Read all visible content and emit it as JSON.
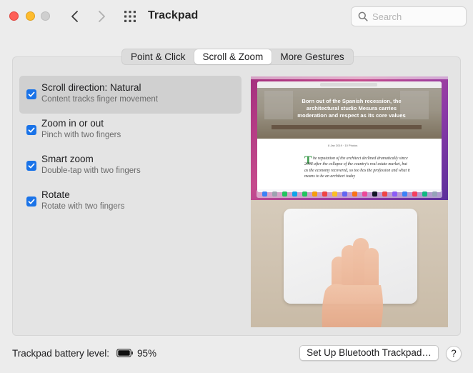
{
  "window": {
    "title": "Trackpad",
    "traffic_lights": [
      "close",
      "minimize",
      "zoom"
    ],
    "nav": {
      "back_icon": "chevron-left",
      "forward_icon": "chevron-right",
      "grid_icon": "show-all-grid"
    }
  },
  "search": {
    "placeholder": "Search",
    "value": ""
  },
  "tabs": [
    {
      "label": "Point & Click",
      "active": false
    },
    {
      "label": "Scroll & Zoom",
      "active": true
    },
    {
      "label": "More Gestures",
      "active": false
    }
  ],
  "options": [
    {
      "title": "Scroll direction: Natural",
      "subtitle": "Content tracks finger movement",
      "checked": true,
      "selected": true
    },
    {
      "title": "Zoom in or out",
      "subtitle": "Pinch with two fingers",
      "checked": true,
      "selected": false
    },
    {
      "title": "Smart zoom",
      "subtitle": "Double-tap with two fingers",
      "checked": true,
      "selected": false
    },
    {
      "title": "Rotate",
      "subtitle": "Rotate with two fingers",
      "checked": true,
      "selected": false
    }
  ],
  "preview": {
    "headline": "Born out of the Spanish recession, the architectural studio Mesura carries moderation and respect as its core values",
    "byline": "8 Jan 2019 · 10 Photos",
    "dropcap": "T",
    "body": "he reputation of the architect declined dramatically since 2008 after the collapse of the country's real estate market, but as the economy recovered, so too has the profession and what it means to be an architect today"
  },
  "footer": {
    "battery_label": "Trackpad battery level:",
    "battery_value": "95%",
    "battery_level": 0.95,
    "setup_button": "Set Up Bluetooth Trackpad…",
    "help_button": "?"
  },
  "colors": {
    "accent": "#1a73e8",
    "selected_row": "#d0d0d0",
    "close": "#fe5f57",
    "minimize": "#febc2e"
  }
}
